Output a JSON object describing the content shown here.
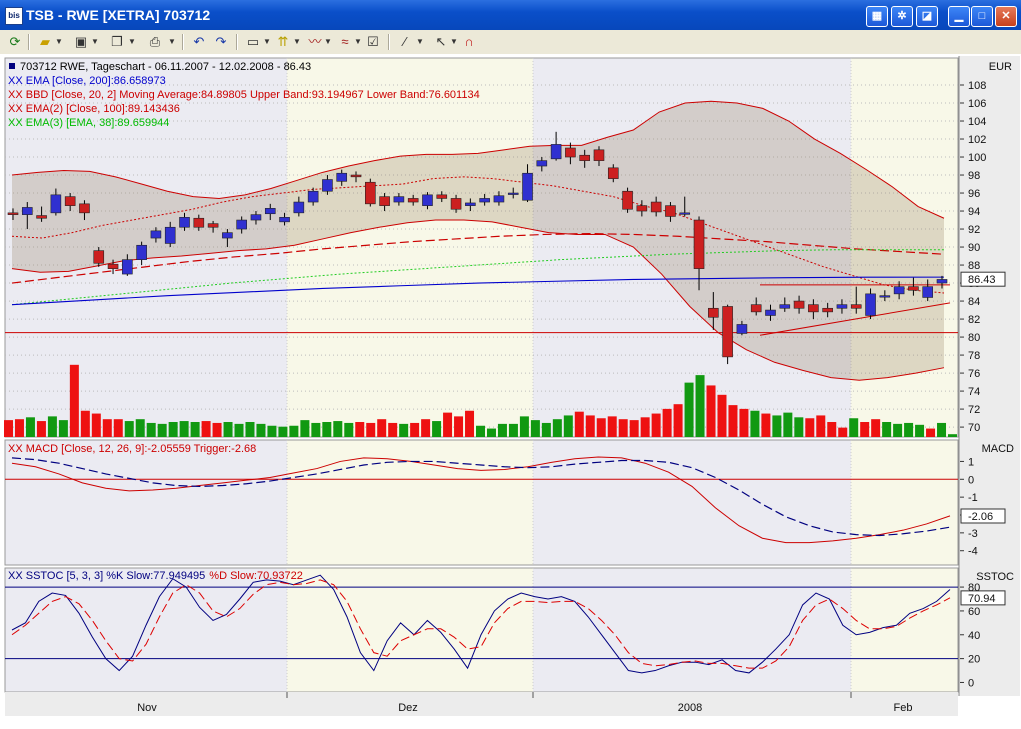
{
  "window": {
    "title": "TSB - RWE [XETRA] 703712",
    "app_icon_text": "bis"
  },
  "toolbar": {
    "icons": [
      "refresh-icon",
      "open-folder-icon",
      "save-icon",
      "copy-icon",
      "print-icon",
      "undo-icon",
      "redo-icon",
      "chart-window-icon",
      "candle-icon",
      "indicator-icon",
      "line-style-icon",
      "properties-icon",
      "draw-line-icon",
      "pointer-icon",
      "magnet-icon"
    ]
  },
  "chart_data": [
    {
      "type": "candlestick",
      "panel": "price",
      "header_main": "703712  RWE, Tageschart - 06.11.2007 - 12.02.2008 - 86.43",
      "legend": [
        {
          "text": "XX EMA [Close, 200]:86.658973",
          "color": "#0000cc"
        },
        {
          "text": "XX BBD [Close, 20, 2] Moving Average:84.89805 Upper Band:93.194967 Lower Band:76.601134",
          "color": "#cc0000"
        },
        {
          "text": "XX EMA(2) [Close, 100]:89.143436",
          "color": "#cc0000"
        },
        {
          "text": "XX EMA(3) [EMA, 38]:89.659944",
          "color": "#00bb00"
        }
      ],
      "axis_title": "EUR",
      "y_ticks": [
        70,
        72,
        74,
        76,
        78,
        80,
        82,
        84,
        86,
        88,
        90,
        92,
        94,
        96,
        98,
        100,
        102,
        104,
        106,
        108
      ],
      "last_value_label": "86.43",
      "last_value": 86.43,
      "ylim": [
        68.9,
        111
      ],
      "x_labels": [
        "Nov",
        "Dez",
        "2008",
        "Feb"
      ],
      "candles": [
        {
          "o": 93.8,
          "c": 93.6,
          "h": 94.3,
          "l": 93.0
        },
        {
          "o": 93.6,
          "c": 94.4,
          "h": 95.0,
          "l": 92.0
        },
        {
          "o": 93.5,
          "c": 93.2,
          "h": 94.5,
          "l": 92.8
        },
        {
          "o": 93.8,
          "c": 95.8,
          "h": 96.5,
          "l": 93.5
        },
        {
          "o": 95.6,
          "c": 94.6,
          "h": 96.0,
          "l": 94.0
        },
        {
          "o": 94.8,
          "c": 93.8,
          "h": 95.2,
          "l": 93.0
        },
        {
          "o": 89.6,
          "c": 88.2,
          "h": 90.0,
          "l": 87.8
        },
        {
          "o": 88.1,
          "c": 87.6,
          "h": 88.6,
          "l": 87.0
        },
        {
          "o": 87.0,
          "c": 88.6,
          "h": 89.2,
          "l": 86.8
        },
        {
          "o": 88.6,
          "c": 90.2,
          "h": 90.6,
          "l": 88.0
        },
        {
          "o": 91.0,
          "c": 91.8,
          "h": 92.2,
          "l": 90.5
        },
        {
          "o": 90.4,
          "c": 92.2,
          "h": 92.8,
          "l": 90.0
        },
        {
          "o": 92.2,
          "c": 93.3,
          "h": 93.8,
          "l": 91.8
        },
        {
          "o": 93.2,
          "c": 92.2,
          "h": 93.6,
          "l": 91.8
        },
        {
          "o": 92.6,
          "c": 92.2,
          "h": 92.9,
          "l": 91.6
        },
        {
          "o": 91.0,
          "c": 91.6,
          "h": 92.0,
          "l": 90.0
        },
        {
          "o": 92.0,
          "c": 93.0,
          "h": 93.4,
          "l": 91.5
        },
        {
          "o": 93.0,
          "c": 93.6,
          "h": 94.0,
          "l": 92.5
        },
        {
          "o": 93.7,
          "c": 94.3,
          "h": 94.8,
          "l": 93.0
        },
        {
          "o": 92.8,
          "c": 93.3,
          "h": 93.8,
          "l": 92.4
        },
        {
          "o": 93.8,
          "c": 95.0,
          "h": 95.6,
          "l": 93.4
        },
        {
          "o": 95.0,
          "c": 96.2,
          "h": 96.6,
          "l": 94.6
        },
        {
          "o": 96.2,
          "c": 97.5,
          "h": 98.0,
          "l": 95.8
        },
        {
          "o": 97.3,
          "c": 98.2,
          "h": 98.6,
          "l": 96.8
        },
        {
          "o": 98.0,
          "c": 97.8,
          "h": 98.4,
          "l": 97.2
        },
        {
          "o": 97.2,
          "c": 94.8,
          "h": 97.6,
          "l": 94.5
        },
        {
          "o": 95.6,
          "c": 94.6,
          "h": 96.0,
          "l": 94.0
        },
        {
          "o": 95.0,
          "c": 95.6,
          "h": 96.0,
          "l": 94.6
        },
        {
          "o": 95.4,
          "c": 95.0,
          "h": 95.8,
          "l": 94.6
        },
        {
          "o": 94.6,
          "c": 95.8,
          "h": 96.1,
          "l": 94.2
        },
        {
          "o": 95.8,
          "c": 95.4,
          "h": 96.2,
          "l": 95.0
        },
        {
          "o": 95.4,
          "c": 94.2,
          "h": 95.8,
          "l": 93.8
        },
        {
          "o": 94.6,
          "c": 94.9,
          "h": 95.4,
          "l": 94.0
        },
        {
          "o": 95.0,
          "c": 95.4,
          "h": 95.9,
          "l": 94.6
        },
        {
          "o": 95.0,
          "c": 95.7,
          "h": 96.2,
          "l": 94.6
        },
        {
          "o": 95.9,
          "c": 96.0,
          "h": 96.6,
          "l": 95.4
        },
        {
          "o": 95.2,
          "c": 98.2,
          "h": 99.2,
          "l": 95.0
        },
        {
          "o": 99.0,
          "c": 99.6,
          "h": 100.0,
          "l": 98.4
        },
        {
          "o": 99.8,
          "c": 101.4,
          "h": 102.8,
          "l": 99.6
        },
        {
          "o": 101.0,
          "c": 100.0,
          "h": 101.6,
          "l": 99.2
        },
        {
          "o": 100.2,
          "c": 99.6,
          "h": 100.8,
          "l": 98.8
        },
        {
          "o": 100.8,
          "c": 99.6,
          "h": 101.2,
          "l": 99.0
        },
        {
          "o": 98.8,
          "c": 97.6,
          "h": 99.2,
          "l": 97.2
        },
        {
          "o": 96.2,
          "c": 94.2,
          "h": 96.6,
          "l": 93.8
        },
        {
          "o": 94.6,
          "c": 94.0,
          "h": 95.2,
          "l": 93.4
        },
        {
          "o": 95.0,
          "c": 93.9,
          "h": 95.6,
          "l": 93.4
        },
        {
          "o": 94.6,
          "c": 93.4,
          "h": 95.0,
          "l": 92.8
        },
        {
          "o": 93.8,
          "c": 93.8,
          "h": 95.6,
          "l": 93.4
        },
        {
          "o": 93.0,
          "c": 87.6,
          "h": 93.4,
          "l": 85.2
        },
        {
          "o": 83.2,
          "c": 82.2,
          "h": 85.0,
          "l": 80.8
        },
        {
          "o": 83.4,
          "c": 77.8,
          "h": 83.6,
          "l": 77.0
        },
        {
          "o": 80.4,
          "c": 81.4,
          "h": 81.8,
          "l": 80.2
        },
        {
          "o": 83.6,
          "c": 82.8,
          "h": 84.4,
          "l": 82.4
        },
        {
          "o": 82.4,
          "c": 83.0,
          "h": 83.6,
          "l": 81.8
        },
        {
          "o": 83.2,
          "c": 83.6,
          "h": 84.4,
          "l": 82.8
        },
        {
          "o": 84.0,
          "c": 83.2,
          "h": 84.6,
          "l": 82.6
        },
        {
          "o": 83.6,
          "c": 82.8,
          "h": 84.2,
          "l": 82.0
        },
        {
          "o": 83.2,
          "c": 82.8,
          "h": 83.8,
          "l": 82.2
        },
        {
          "o": 83.2,
          "c": 83.6,
          "h": 84.2,
          "l": 82.6
        },
        {
          "o": 83.6,
          "c": 83.2,
          "h": 85.6,
          "l": 82.6
        },
        {
          "o": 82.4,
          "c": 84.8,
          "h": 85.4,
          "l": 82.0
        },
        {
          "o": 84.6,
          "c": 84.6,
          "h": 85.2,
          "l": 84.0
        },
        {
          "o": 84.8,
          "c": 85.6,
          "h": 86.2,
          "l": 84.2
        },
        {
          "o": 85.6,
          "c": 85.2,
          "h": 86.6,
          "l": 84.6
        },
        {
          "o": 84.4,
          "c": 85.6,
          "h": 86.4,
          "l": 84.0
        },
        {
          "o": 86.0,
          "c": 86.4,
          "h": 86.8,
          "l": 85.4
        }
      ],
      "volume": [
        18,
        19,
        21,
        17,
        22,
        18,
        77,
        28,
        25,
        19,
        19,
        17,
        19,
        15,
        14,
        16,
        17,
        16,
        17,
        15,
        16,
        14,
        16,
        14,
        12,
        11,
        12,
        18,
        15,
        16,
        17,
        15,
        16,
        15,
        19,
        15,
        14,
        15,
        19,
        17,
        26,
        22,
        28,
        12,
        9,
        14,
        14,
        22,
        18,
        15,
        19,
        23,
        27,
        23,
        20,
        22,
        19,
        18,
        21,
        25,
        30,
        35,
        58,
        66,
        55,
        45,
        34,
        30,
        28,
        25,
        23,
        26,
        21,
        20,
        23,
        16,
        10,
        20,
        16,
        19,
        16,
        14,
        15,
        13,
        9,
        15,
        3
      ],
      "volume_colors": "green when close >= open, red otherwise",
      "upper_band": [
        98,
        98.3,
        98.5,
        98.4,
        97.8,
        97,
        96.2,
        95.6,
        95.4,
        95.8,
        96.5,
        97.4,
        98.3,
        99,
        99.6,
        100.1,
        100.3,
        100.3,
        100.4,
        100.8,
        101.2,
        101.3,
        101.3,
        102.2,
        103,
        105,
        106,
        106.2,
        106,
        105.4,
        104,
        102,
        100.4,
        98.6,
        96.7,
        94.5,
        93.2
      ],
      "lower_band": [
        87.6,
        87.2,
        87.3,
        87.9,
        88.5,
        88.8,
        89,
        89.3,
        89.6,
        89.8,
        90.2,
        90.9,
        91.6,
        92.2,
        92.7,
        93,
        93,
        92.8,
        92.2,
        91.6,
        91.4,
        91.4,
        90,
        87,
        83.4,
        80.5,
        78.6,
        77.2,
        76.3,
        75.5,
        75.2,
        75.5,
        76,
        76.6
      ]
    },
    {
      "type": "line",
      "panel": "macd",
      "legend_text": "XX MACD [Close, 12, 26, 9]:-2.05559 Trigger:-2.68",
      "axis_title": "MACD",
      "y_ticks": [
        -4,
        -3,
        -2,
        -1,
        0,
        1
      ],
      "last_value_label": "-2.06",
      "macd": -2.05559,
      "trigger": -2.68,
      "ylim": [
        -4.8,
        2.2
      ],
      "series": [
        {
          "name": "MACD",
          "color": "#cc0000",
          "values": [
            0.9,
            0.7,
            0.3,
            -0.2,
            -0.5,
            -0.65,
            -0.6,
            -0.5,
            -0.35,
            -0.2,
            -0.05,
            0.1,
            0.35,
            0.6,
            1.0,
            1.2,
            1.15,
            1.0,
            0.8,
            0.6,
            0.5,
            0.55,
            0.7,
            0.95,
            1.15,
            1.25,
            1.2,
            0.9,
            0.4,
            -0.4,
            -1.6,
            -2.6,
            -3.3,
            -3.55,
            -3.55,
            -3.45,
            -3.3,
            -3.1,
            -2.85,
            -2.5,
            -2.05
          ]
        },
        {
          "name": "Trigger",
          "color": "#000080",
          "values": [
            1.2,
            1.1,
            0.9,
            0.6,
            0.3,
            0.05,
            -0.2,
            -0.35,
            -0.4,
            -0.35,
            -0.25,
            -0.1,
            0.1,
            0.3,
            0.55,
            0.8,
            0.95,
            1.0,
            1.0,
            0.9,
            0.8,
            0.7,
            0.65,
            0.7,
            0.85,
            0.95,
            1.05,
            1.05,
            0.95,
            0.65,
            0.1,
            -0.6,
            -1.4,
            -2.1,
            -2.6,
            -2.95,
            -3.1,
            -3.15,
            -3.05,
            -2.9,
            -2.68
          ]
        }
      ],
      "zero_line_color": "#cc0000"
    },
    {
      "type": "line",
      "panel": "stochastic",
      "legend_k": "XX SSTOC [5, 3, 3] %K Slow:77.949495",
      "legend_d": "%D Slow:70.93722",
      "axis_title": "SSTOC",
      "y_ticks": [
        0,
        20,
        40,
        60,
        80
      ],
      "last_value_label": "70.94",
      "k_slow": 77.949495,
      "d_slow": 70.93722,
      "ylim": [
        -8,
        96
      ],
      "levels": [
        20,
        80
      ],
      "series": [
        {
          "name": "%K Slow",
          "color": "#000080",
          "values": [
            44,
            50,
            68,
            75,
            73,
            58,
            38,
            20,
            10,
            22,
            48,
            72,
            87,
            80,
            63,
            52,
            57,
            70,
            84,
            86,
            85,
            82,
            86,
            90,
            78,
            55,
            25,
            10,
            35,
            50,
            40,
            52,
            42,
            28,
            12,
            40,
            60,
            70,
            75,
            72,
            70,
            72,
            68,
            55,
            40,
            25,
            10,
            8,
            10,
            14,
            17,
            17,
            15,
            19,
            10,
            8,
            17,
            28,
            40,
            65,
            75,
            70,
            48,
            40,
            42,
            46,
            48,
            58,
            62,
            68,
            78
          ]
        },
        {
          "name": "%D Slow",
          "color": "#dd0000",
          "values": [
            40,
            48,
            58,
            68,
            72,
            66,
            52,
            35,
            20,
            18,
            32,
            55,
            75,
            82,
            75,
            60,
            55,
            62,
            74,
            82,
            84,
            82,
            83,
            86,
            82,
            68,
            45,
            25,
            22,
            35,
            40,
            45,
            45,
            38,
            28,
            30,
            50,
            62,
            68,
            68,
            67,
            68,
            68,
            62,
            52,
            40,
            25,
            16,
            14,
            15,
            17,
            18,
            16,
            16,
            14,
            12,
            12,
            18,
            30,
            52,
            65,
            70,
            62,
            52,
            45,
            45,
            47,
            54,
            60,
            65,
            71
          ]
        }
      ]
    }
  ]
}
